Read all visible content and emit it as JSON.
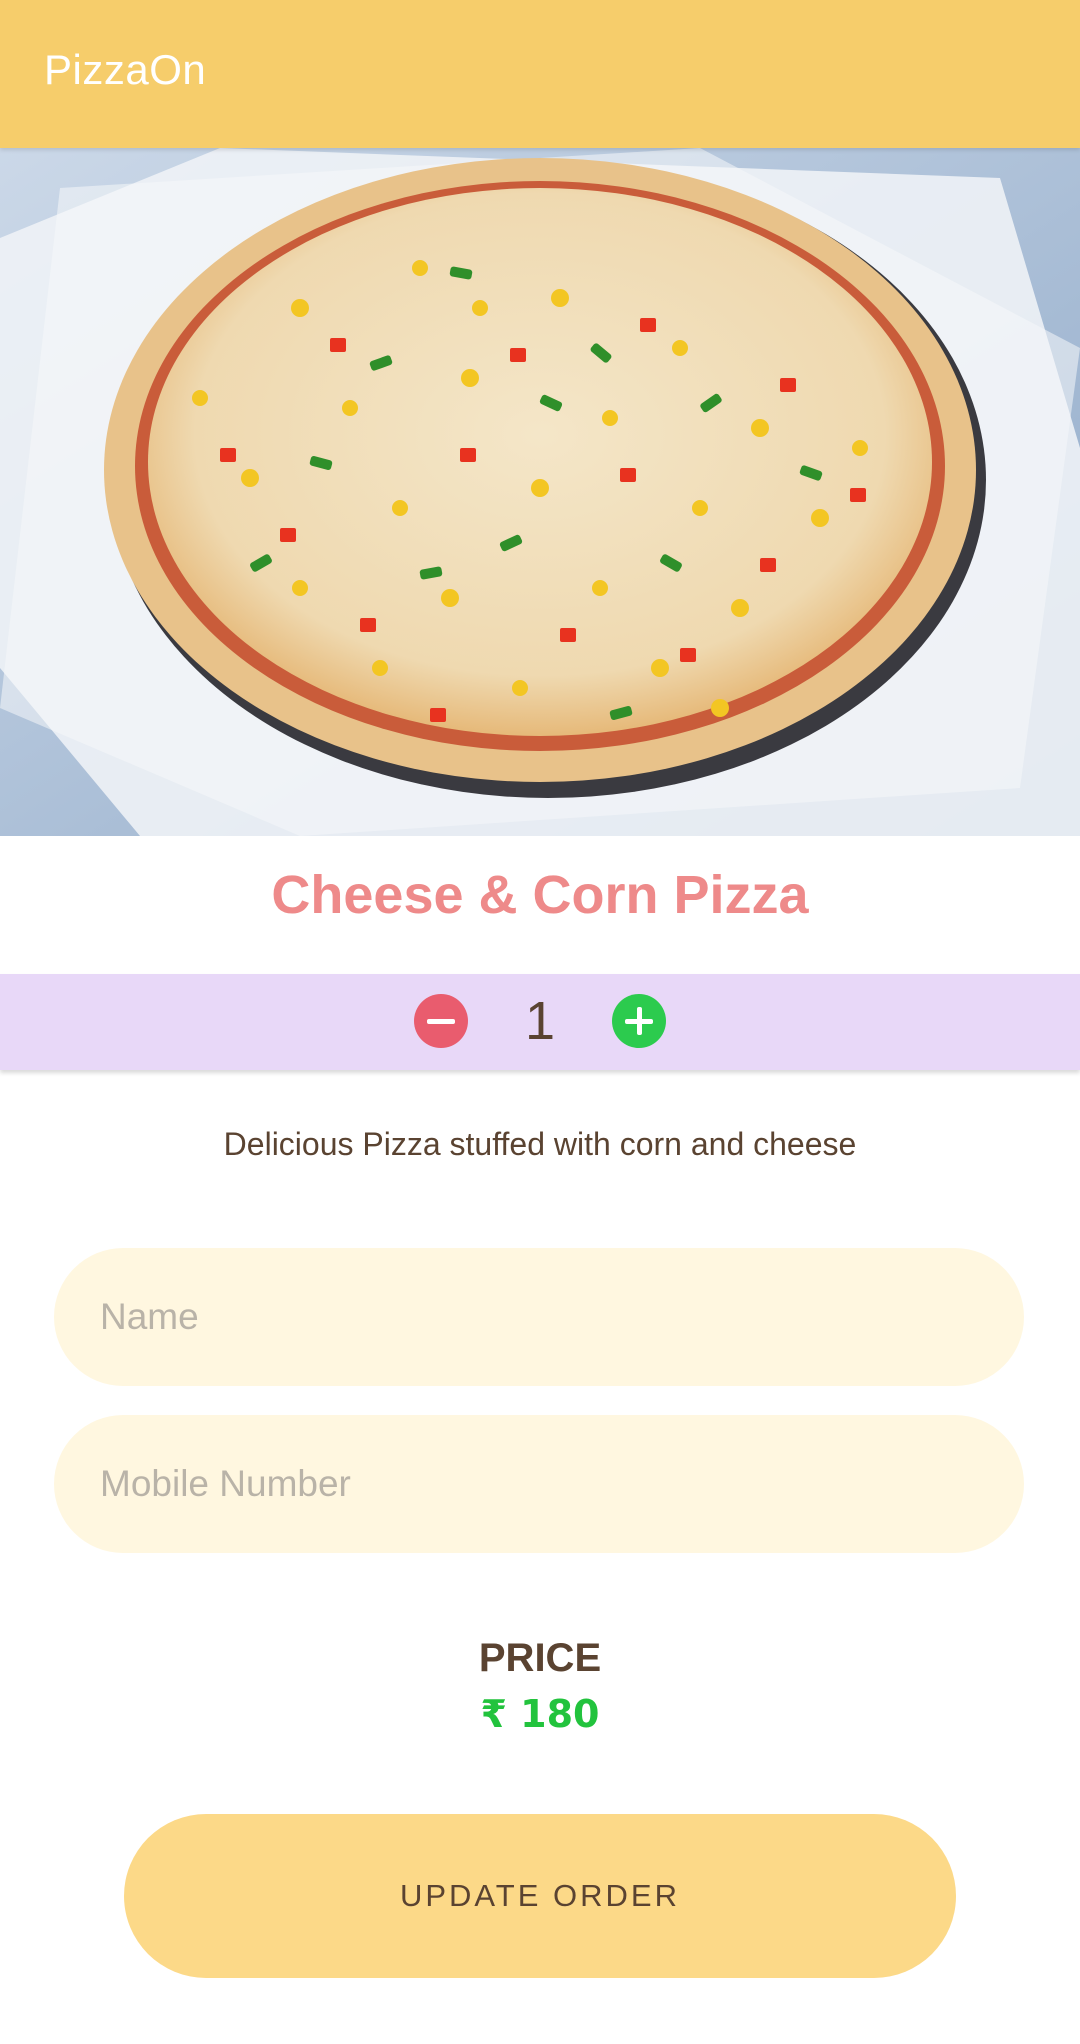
{
  "app_bar": {
    "title": "PizzaOn",
    "background_color": "#F6CD6B"
  },
  "product": {
    "image_icon": "pizza-photo",
    "name": "Cheese & Corn Pizza",
    "description": "Delicious Pizza stuffed with corn and cheese"
  },
  "quantity": {
    "value": "1",
    "decrement_icon": "minus-circle-icon",
    "increment_icon": "plus-circle-icon",
    "decrement_color": "#E95C6E",
    "increment_color": "#2CCB4E"
  },
  "form": {
    "name_placeholder": "Name",
    "mobile_placeholder": "Mobile Number"
  },
  "price": {
    "label": "PRICE",
    "value": "₹ 180",
    "color": "#22C33D"
  },
  "actions": {
    "update_label": "UPDATE ORDER"
  }
}
